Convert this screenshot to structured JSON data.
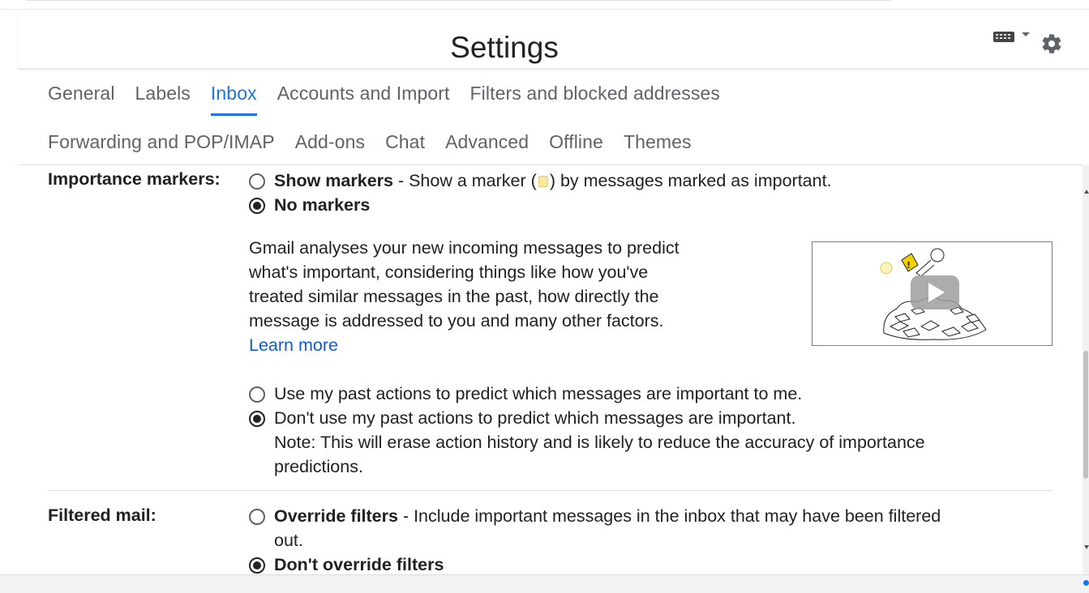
{
  "header": {
    "title": "Settings"
  },
  "tabs": {
    "row1": [
      {
        "label": "General"
      },
      {
        "label": "Labels"
      },
      {
        "label": "Inbox",
        "active": true
      },
      {
        "label": "Accounts and Import"
      },
      {
        "label": "Filters and blocked addresses"
      }
    ],
    "row2": [
      {
        "label": "Forwarding and POP/IMAP"
      },
      {
        "label": "Add-ons"
      },
      {
        "label": "Chat"
      },
      {
        "label": "Advanced"
      },
      {
        "label": "Offline"
      },
      {
        "label": "Themes"
      }
    ]
  },
  "importance": {
    "label": "Importance markers:",
    "show_markers": {
      "title": "Show markers",
      "desc_pre": " - Show a marker (",
      "desc_post": ") by messages marked as important.",
      "checked": false
    },
    "no_markers": {
      "title": "No markers",
      "checked": true
    },
    "description": [
      "Gmail analyses your new incoming messages to predict",
      "what's important, considering things like how you've",
      "treated similar messages in the past, how directly the",
      "message is addressed to you and many other factors."
    ],
    "learn_more": "Learn more",
    "use_past": {
      "text": "Use my past actions to predict which messages are important to me.",
      "checked": false
    },
    "dont_use_past": {
      "text": "Don't use my past actions to predict which messages are important.",
      "note1": "Note: This will erase action history and is likely to reduce the accuracy of importance",
      "note2": "predictions.",
      "checked": true
    }
  },
  "filtered": {
    "label": "Filtered mail:",
    "override": {
      "title": "Override filters",
      "desc": " - Include important messages in the inbox that may have been filtered",
      "desc2": "out.",
      "checked": false
    },
    "dont_override": {
      "title": "Don't override filters",
      "checked": true
    }
  },
  "icons": {
    "keyboard": "keyboard-icon",
    "dropdown": "chevron-down-icon",
    "settings": "gear-icon",
    "marker": "importance-marker-icon",
    "video": "play-video-icon"
  },
  "colors": {
    "accent": "#1a73e8",
    "link": "#1558d6",
    "text": "#202124",
    "muted": "#5f6368",
    "marker": "#f7e7a1"
  }
}
